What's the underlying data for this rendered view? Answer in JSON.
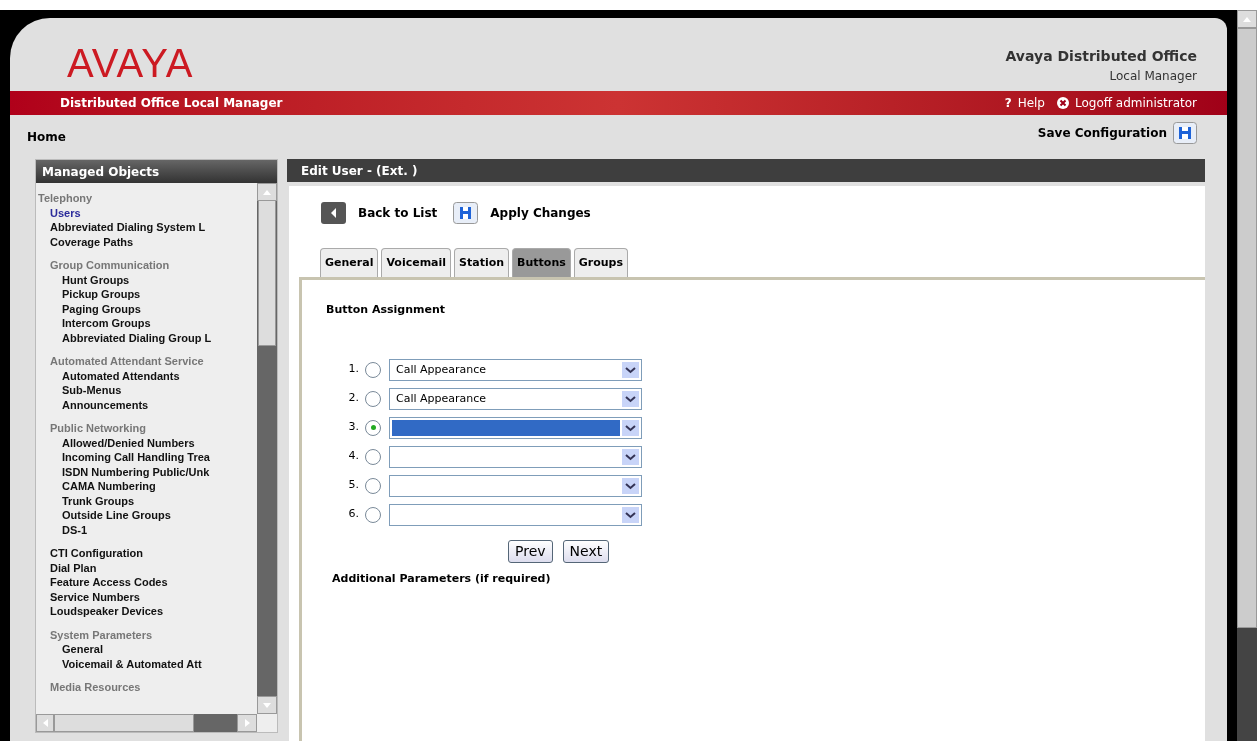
{
  "header": {
    "logo": "AVAYA",
    "product_title": "Avaya Distributed Office",
    "product_subtitle": "Local Manager"
  },
  "red_bar": {
    "title": "Distributed Office Local Manager",
    "help": "Help",
    "help_icon": "?",
    "logoff": "Logoff administrator"
  },
  "breadcrumb": "Home",
  "save_configuration": "Save Configuration",
  "sidebar": {
    "title": "Managed Objects",
    "items": [
      {
        "label": "Telephony",
        "kind": "heading",
        "children": [
          {
            "label": "Users",
            "kind": "link",
            "selected": true
          },
          {
            "label": "Abbreviated Dialing System L",
            "kind": "link",
            "selected": false
          },
          {
            "label": "Coverage Paths",
            "kind": "link",
            "selected": false
          },
          {
            "label": "Group Communication",
            "kind": "heading",
            "children": [
              {
                "label": "Hunt Groups",
                "kind": "link",
                "selected": false
              },
              {
                "label": "Pickup Groups",
                "kind": "link",
                "selected": false
              },
              {
                "label": "Paging Groups",
                "kind": "link",
                "selected": false
              },
              {
                "label": "Intercom Groups",
                "kind": "link",
                "selected": false
              },
              {
                "label": "Abbreviated Dialing Group L",
                "kind": "link",
                "selected": false
              }
            ]
          },
          {
            "label": "Automated Attendant Service",
            "kind": "heading",
            "children": [
              {
                "label": "Automated Attendants",
                "kind": "link",
                "selected": false
              },
              {
                "label": "Sub-Menus",
                "kind": "link",
                "selected": false
              },
              {
                "label": "Announcements",
                "kind": "link",
                "selected": false
              }
            ]
          },
          {
            "label": "Public Networking",
            "kind": "heading",
            "children": [
              {
                "label": "Allowed/Denied Numbers",
                "kind": "link",
                "selected": false
              },
              {
                "label": "Incoming Call Handling Trea",
                "kind": "link",
                "selected": false
              },
              {
                "label": "ISDN Numbering Public/Unk",
                "kind": "link",
                "selected": false
              },
              {
                "label": "CAMA Numbering",
                "kind": "link",
                "selected": false
              },
              {
                "label": "Trunk Groups",
                "kind": "link",
                "selected": false
              },
              {
                "label": "Outside Line Groups",
                "kind": "link",
                "selected": false
              },
              {
                "label": "DS-1",
                "kind": "link",
                "selected": false
              }
            ]
          },
          {
            "label": "CTI Configuration",
            "kind": "link",
            "selected": false
          },
          {
            "label": "Dial Plan",
            "kind": "link",
            "selected": false
          },
          {
            "label": "Feature Access Codes",
            "kind": "link",
            "selected": false
          },
          {
            "label": "Service Numbers",
            "kind": "link",
            "selected": false
          },
          {
            "label": "Loudspeaker Devices",
            "kind": "link",
            "selected": false
          },
          {
            "label": "System Parameters",
            "kind": "heading",
            "children": [
              {
                "label": "General",
                "kind": "link",
                "selected": false
              },
              {
                "label": "Voicemail & Automated Att",
                "kind": "link",
                "selected": false
              }
            ]
          },
          {
            "label": "Media Resources",
            "kind": "heading"
          }
        ]
      }
    ]
  },
  "main": {
    "title": "Edit User - (Ext. )",
    "back": "Back to List",
    "apply": "Apply Changes",
    "tabs": [
      {
        "label": "General",
        "selected": false
      },
      {
        "label": "Voicemail",
        "selected": false
      },
      {
        "label": "Station",
        "selected": false
      },
      {
        "label": "Buttons",
        "selected": true
      },
      {
        "label": "Groups",
        "selected": false
      }
    ],
    "section_title": "Button Assignment",
    "buttons": [
      {
        "number": "1.",
        "selected": false,
        "value": "Call Appearance",
        "highlighted": false
      },
      {
        "number": "2.",
        "selected": false,
        "value": "Call Appearance",
        "highlighted": false
      },
      {
        "number": "3.",
        "selected": true,
        "highlighted": true
      },
      {
        "number": "4.",
        "selected": false,
        "highlighted": false
      },
      {
        "number": "5.",
        "selected": false,
        "highlighted": false
      },
      {
        "number": "6.",
        "selected": false,
        "highlighted": false
      }
    ],
    "prev": "Prev",
    "next": "Next",
    "additional": "Additional Parameters (if required)"
  }
}
